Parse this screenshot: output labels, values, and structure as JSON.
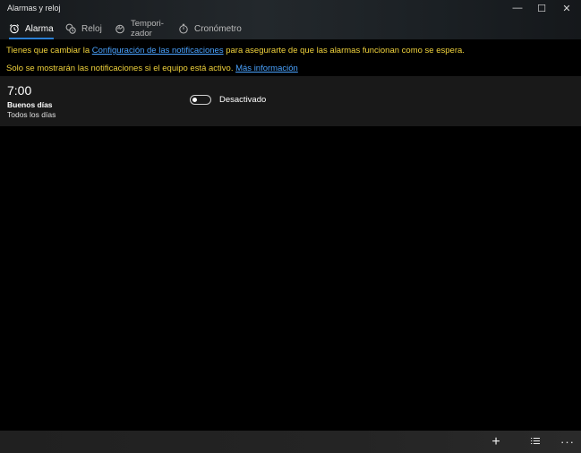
{
  "window": {
    "title": "Alarmas y reloj",
    "controls": {
      "minimize": "—",
      "maximize": "☐",
      "close": "✕"
    }
  },
  "tabs": [
    {
      "label": "Alarma",
      "icon": "alarm-clock-icon",
      "active": true
    },
    {
      "label": "Reloj",
      "icon": "world-clock-icon",
      "active": false
    },
    {
      "label_line1": "Tempori-",
      "label_line2": "zador",
      "icon": "timer-icon",
      "active": false
    },
    {
      "label": "Cronómetro",
      "icon": "stopwatch-icon",
      "active": false
    }
  ],
  "notices": {
    "notice1": {
      "prefix": "Tienes que cambiar la ",
      "link": "Configuración de las notificaciones",
      "suffix": " para asegurarte de que las alarmas funcionan como se espera."
    },
    "notice2": {
      "prefix": "Solo se mostrarán las notificaciones si el equipo está activo. ",
      "link": "Más información"
    }
  },
  "alarms": [
    {
      "time": "7:00",
      "name": "Buenos días",
      "repeat": "Todos los días",
      "status": "Desactivado",
      "enabled": false
    }
  ],
  "commandbar": {
    "add_icon": "add-icon",
    "edit_icon": "select-list-icon",
    "more_icon": "more-icon",
    "add": "+",
    "more": "···"
  },
  "colors": {
    "accent": "#2a7fd4",
    "notice_text": "#f0d23c",
    "link": "#4aa3ff",
    "background": "#000000",
    "alarm_row": "#191919"
  }
}
